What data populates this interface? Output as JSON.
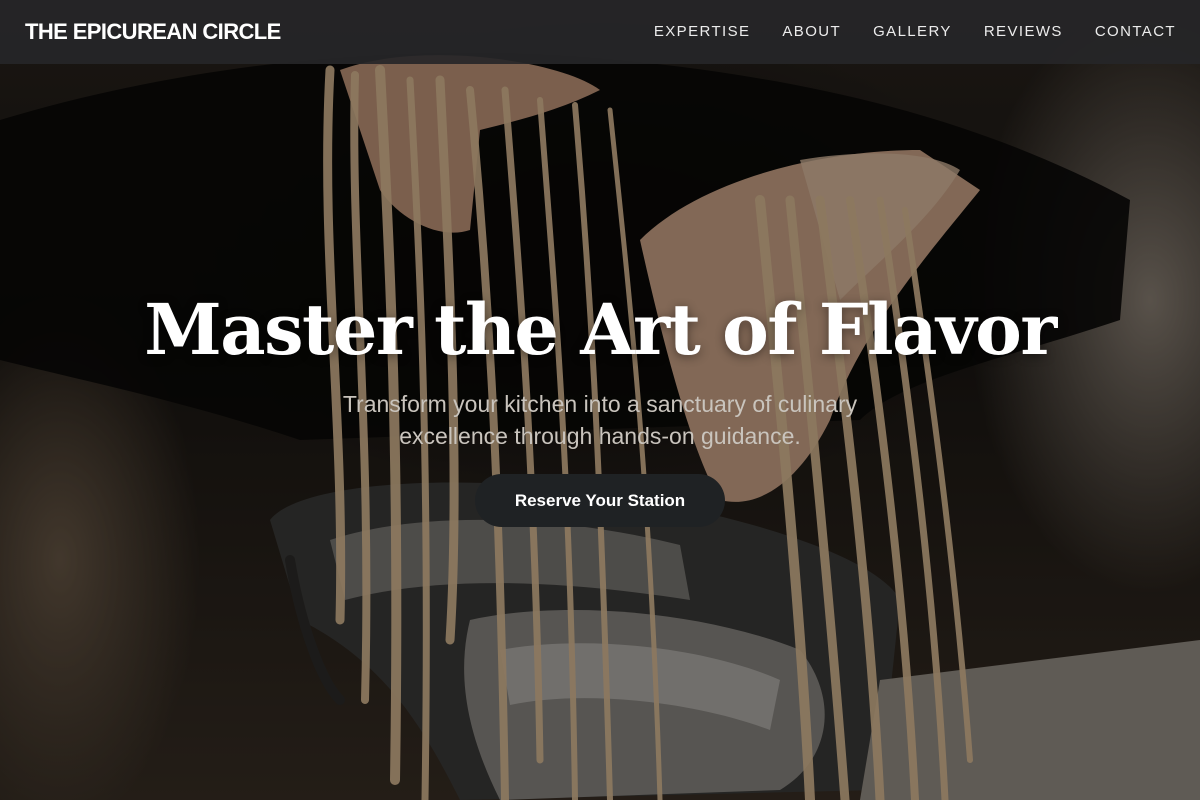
{
  "brand": {
    "name": "THE EPICUREAN CIRCLE"
  },
  "nav": {
    "items": [
      {
        "label": "EXPERTISE"
      },
      {
        "label": "ABOUT"
      },
      {
        "label": "GALLERY"
      },
      {
        "label": "REVIEWS"
      },
      {
        "label": "CONTACT"
      }
    ]
  },
  "hero": {
    "title": "Master the Art of Flavor",
    "subtitle": "Transform your kitchen into a sanctuary of culinary excellence through hands-on guidance.",
    "cta_label": "Reserve Your Station",
    "background": "hands-pulling-fresh-pasta-from-pasta-machine-photo"
  },
  "colors": {
    "nav_background": "#262628",
    "cta_background": "#1f2224",
    "title_text": "#ffffff",
    "subtitle_text": "#c9c4bd"
  }
}
